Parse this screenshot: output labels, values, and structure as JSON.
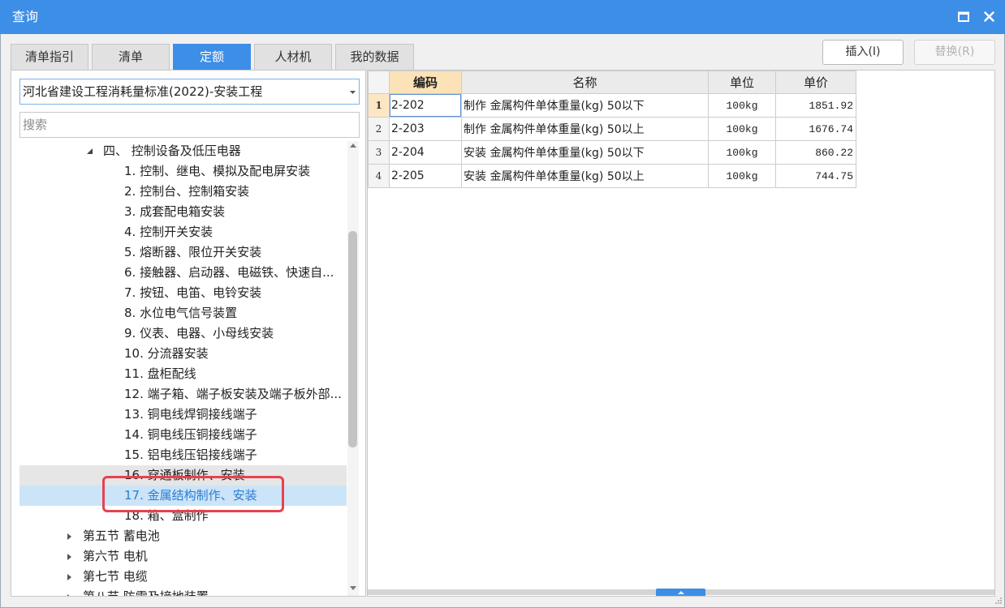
{
  "window": {
    "title": "查询",
    "icons": {
      "maximize": "maximize-icon",
      "close": "close-icon"
    }
  },
  "tabs": [
    {
      "label": "清单指引",
      "active": false
    },
    {
      "label": "清单",
      "active": false
    },
    {
      "label": "定额",
      "active": true
    },
    {
      "label": "人材机",
      "active": false
    },
    {
      "label": "我的数据",
      "active": false
    }
  ],
  "toolbar": {
    "insert_label": "插入(I)",
    "replace_label": "替换(R)",
    "replace_enabled": false
  },
  "library_select": {
    "value": "河北省建设工程消耗量标准(2022)-安装工程",
    "icon": "chevron-down-icon"
  },
  "search": {
    "placeholder": "搜索",
    "icon": null
  },
  "tree": {
    "items": [
      {
        "label": "四、 控制设备及低压电器",
        "expandable": true,
        "expanded": true
      },
      {
        "label": "1. 控制、继电、模拟及配电屏安装"
      },
      {
        "label": "2. 控制台、控制箱安装"
      },
      {
        "label": "3. 成套配电箱安装"
      },
      {
        "label": "4. 控制开关安装"
      },
      {
        "label": "5. 熔断器、限位开关安装"
      },
      {
        "label": "6. 接触器、启动器、电磁铁、快速自..."
      },
      {
        "label": "7. 按钮、电笛、电铃安装"
      },
      {
        "label": "8. 水位电气信号装置"
      },
      {
        "label": "9. 仪表、电器、小母线安装"
      },
      {
        "label": "10. 分流器安装"
      },
      {
        "label": "11. 盘柜配线"
      },
      {
        "label": "12. 端子箱、端子板安装及端子板外部..."
      },
      {
        "label": "13. 铜电线焊铜接线端子"
      },
      {
        "label": "14. 铜电线压铜接线端子"
      },
      {
        "label": "15. 铝电线压铝接线端子"
      },
      {
        "label": "16. 穿通板制作、安装",
        "hover": true
      },
      {
        "label": "17. 金属结构制作、安装",
        "selected": true
      },
      {
        "label": "18. 箱、盒制作"
      },
      {
        "label": "第五节 蓄电池",
        "expandable": true,
        "expanded": false
      },
      {
        "label": "第六节 电机",
        "expandable": true,
        "expanded": false
      },
      {
        "label": "第七节 电缆",
        "expandable": true,
        "expanded": false
      },
      {
        "label": "第八节 防雷及接地装置",
        "expandable": true,
        "expanded": false
      }
    ]
  },
  "table": {
    "columns": [
      {
        "label": "编码",
        "active": true
      },
      {
        "label": "名称",
        "active": false
      },
      {
        "label": "单位",
        "active": false
      },
      {
        "label": "单价",
        "active": false
      }
    ],
    "current_row": 1,
    "rows": [
      {
        "index": "1",
        "code": "2-202",
        "name": "制作 金属构件单体重量(kg) 50以下",
        "unit": "100kg",
        "price": "1851.92"
      },
      {
        "index": "2",
        "code": "2-203",
        "name": "制作 金属构件单体重量(kg) 50以上",
        "unit": "100kg",
        "price": "1676.74"
      },
      {
        "index": "3",
        "code": "2-204",
        "name": "安装 金属构件单体重量(kg) 50以下",
        "unit": "100kg",
        "price": "860.22"
      },
      {
        "index": "4",
        "code": "2-205",
        "name": "安装 金属构件单体重量(kg) 50以上",
        "unit": "100kg",
        "price": "744.75"
      }
    ]
  },
  "colors": {
    "title_bar": "#3d8ee6",
    "active_tab": "#3d8ee6",
    "selected_tree_row": "#cce4f7",
    "selected_tree_text": "#2b7cd3",
    "active_column_header": "#fce2b7",
    "highlight_box": "#e8414f"
  }
}
